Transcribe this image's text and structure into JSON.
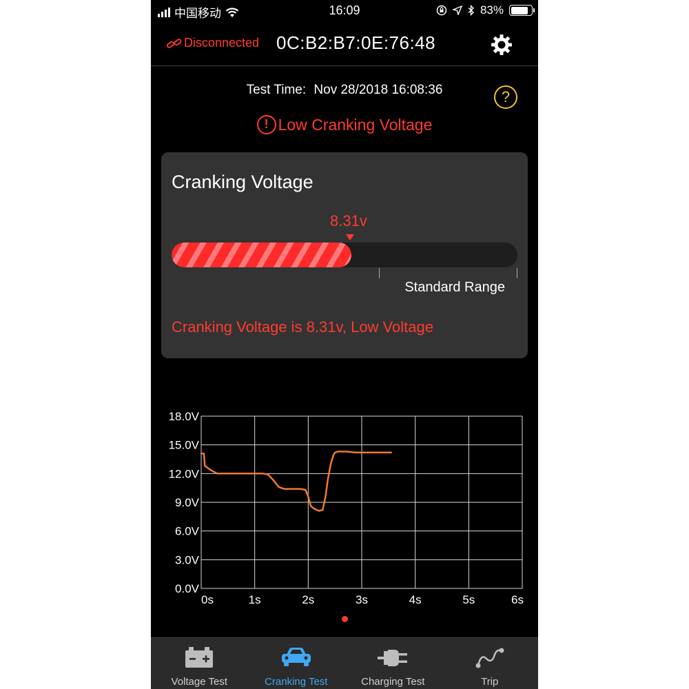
{
  "status_bar": {
    "carrier": "中国移动",
    "time": "16:09",
    "battery": "83%",
    "battery_level": 0.83
  },
  "header": {
    "connection_status": "Disconnected",
    "device_mac": "0C:B2:B7:0E:76:48"
  },
  "test_info": {
    "time_label": "Test Time:",
    "time_value": "Nov 28/2018 16:08:36",
    "status_alert": "Low Cranking Voltage",
    "alert_icon": "!",
    "help_icon": "?"
  },
  "card": {
    "title": "Cranking Voltage",
    "gauge_value": "8.31v",
    "gauge_fill": 0.52,
    "range_label": "Standard Range",
    "message": "Cranking Voltage is 8.31v, Low Voltage"
  },
  "colors": {
    "alert": "#ff3b30",
    "line": "#f07a2a",
    "help": "#f2c230",
    "active_tab": "#3fa8f0"
  },
  "chart_data": {
    "type": "line",
    "x_ticks": [
      "0s",
      "1s",
      "2s",
      "3s",
      "4s",
      "5s",
      "6s"
    ],
    "y_ticks": [
      "0.0V",
      "3.0V",
      "6.0V",
      "9.0V",
      "12.0V",
      "15.0V",
      "18.0V"
    ],
    "xlim": [
      0,
      6
    ],
    "ylim": [
      0,
      18
    ],
    "grid": true,
    "series": [
      {
        "color": "#f07a2a",
        "x": [
          0,
          0.05,
          0.07,
          0.12,
          0.2,
          0.3,
          0.5,
          0.8,
          1.0,
          1.15,
          1.25,
          1.35,
          1.45,
          1.55,
          1.7,
          1.85,
          1.95,
          2.0,
          2.05,
          2.12,
          2.2,
          2.27,
          2.32,
          2.37,
          2.42,
          2.47,
          2.5,
          2.55,
          2.6,
          2.7,
          2.9,
          3.2,
          3.5,
          3.55
        ],
        "y": [
          14.1,
          14.1,
          12.8,
          12.6,
          12.3,
          12.0,
          12.0,
          12.0,
          12.0,
          12.0,
          11.9,
          11.3,
          10.6,
          10.4,
          10.4,
          10.4,
          10.3,
          9.6,
          8.6,
          8.3,
          8.1,
          8.2,
          9.5,
          11.5,
          13.0,
          13.9,
          14.2,
          14.3,
          14.3,
          14.3,
          14.2,
          14.2,
          14.2,
          14.2
        ]
      }
    ]
  },
  "tabs": [
    {
      "label": "Voltage Test",
      "icon": "battery-icon",
      "active": false
    },
    {
      "label": "Cranking Test",
      "icon": "car-icon",
      "active": true
    },
    {
      "label": "Charging Test",
      "icon": "plug-icon",
      "active": false
    },
    {
      "label": "Trip",
      "icon": "route-icon",
      "active": false
    }
  ]
}
